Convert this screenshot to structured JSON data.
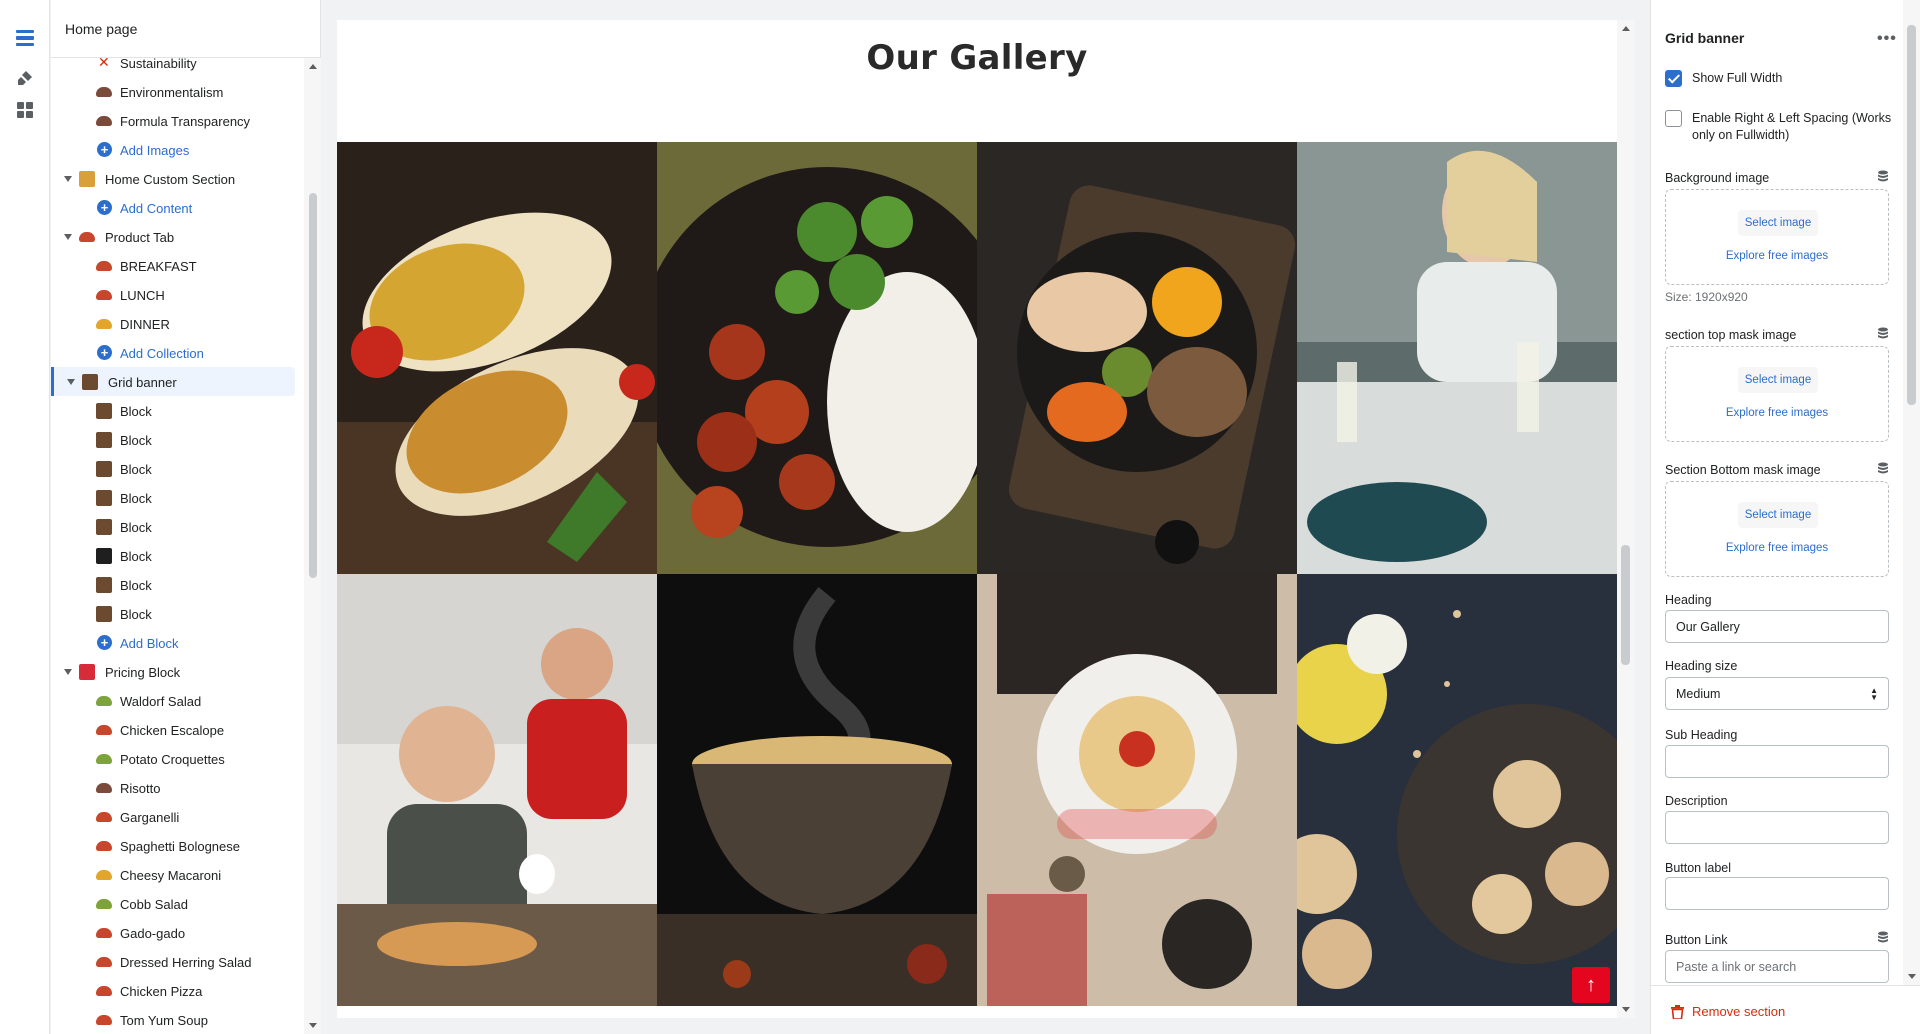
{
  "tree": {
    "header": "Home page",
    "rows": [
      {
        "type": "child",
        "label": "Sustainability",
        "thumb": "cross"
      },
      {
        "type": "child",
        "label": "Environmentalism",
        "thumb": "bowl"
      },
      {
        "type": "child",
        "label": "Formula Transparency",
        "thumb": "bowl"
      },
      {
        "type": "add",
        "label": "Add Images"
      },
      {
        "type": "section",
        "label": "Home Custom Section",
        "thumb": "multi"
      },
      {
        "type": "add",
        "label": "Add Content"
      },
      {
        "type": "section",
        "label": "Product Tab",
        "thumb": "food"
      },
      {
        "type": "child",
        "label": "BREAKFAST",
        "thumb": "food"
      },
      {
        "type": "child",
        "label": "LUNCH",
        "thumb": "food"
      },
      {
        "type": "child",
        "label": "DINNER",
        "thumb": "yellow"
      },
      {
        "type": "add",
        "label": "Add Collection"
      },
      {
        "type": "section",
        "label": "Grid banner",
        "thumb": "photo",
        "selected": true
      },
      {
        "type": "child",
        "label": "Block",
        "thumb": "photo"
      },
      {
        "type": "child",
        "label": "Block",
        "thumb": "photo"
      },
      {
        "type": "child",
        "label": "Block",
        "thumb": "photo"
      },
      {
        "type": "child",
        "label": "Block",
        "thumb": "photo"
      },
      {
        "type": "child",
        "label": "Block",
        "thumb": "photo"
      },
      {
        "type": "child",
        "label": "Block",
        "thumb": "dark"
      },
      {
        "type": "child",
        "label": "Block",
        "thumb": "photo"
      },
      {
        "type": "child",
        "label": "Block",
        "thumb": "photo"
      },
      {
        "type": "add",
        "label": "Add Block"
      },
      {
        "type": "section",
        "label": "Pricing Block",
        "thumb": "pricing"
      },
      {
        "type": "child",
        "label": "Waldorf Salad",
        "thumb": "salad"
      },
      {
        "type": "child",
        "label": "Chicken Escalope",
        "thumb": "food"
      },
      {
        "type": "child",
        "label": "Potato Croquettes",
        "thumb": "salad"
      },
      {
        "type": "child",
        "label": "Risotto",
        "thumb": "bowl"
      },
      {
        "type": "child",
        "label": "Garganelli",
        "thumb": "food"
      },
      {
        "type": "child",
        "label": "Spaghetti Bolognese",
        "thumb": "food"
      },
      {
        "type": "child",
        "label": "Cheesy Macaroni",
        "thumb": "yellow"
      },
      {
        "type": "child",
        "label": "Cobb Salad",
        "thumb": "salad"
      },
      {
        "type": "child",
        "label": "Gado-gado",
        "thumb": "food"
      },
      {
        "type": "child",
        "label": "Dressed Herring Salad",
        "thumb": "food"
      },
      {
        "type": "child",
        "label": "Chicken Pizza",
        "thumb": "food"
      },
      {
        "type": "child",
        "label": "Tom Yum Soup",
        "thumb": "food"
      }
    ]
  },
  "preview": {
    "heading": "Our Gallery",
    "tiles": [
      "burrito",
      "chicken-rice",
      "chicken-bowl",
      "dinner-party",
      "friends-pizza",
      "soup-bowl",
      "spaghetti-plate",
      "dessert"
    ],
    "scroll_top_label": "↑"
  },
  "settings": {
    "title": "Grid banner",
    "show_full_width": {
      "label": "Show Full Width",
      "checked": true
    },
    "spacing": {
      "label": "Enable Right & Left Spacing (Works only on Fullwidth)",
      "checked": false
    },
    "background_image": {
      "label": "Background image",
      "select": "Select image",
      "explore": "Explore free images",
      "size": "Size: 1920x920"
    },
    "top_mask": {
      "label": "section top mask image",
      "select": "Select image",
      "explore": "Explore free images"
    },
    "bottom_mask": {
      "label": "Section Bottom mask image",
      "select": "Select image",
      "explore": "Explore free images"
    },
    "heading": {
      "label": "Heading",
      "value": "Our Gallery"
    },
    "heading_size": {
      "label": "Heading size",
      "value": "Medium"
    },
    "sub_heading": {
      "label": "Sub Heading",
      "value": ""
    },
    "description": {
      "label": "Description",
      "value": ""
    },
    "button_label": {
      "label": "Button label",
      "value": ""
    },
    "button_link": {
      "label": "Button Link",
      "placeholder": "Paste a link or search"
    },
    "remove": "Remove section"
  },
  "colors": {
    "accent": "#2c6ecb",
    "danger": "#d72c0d",
    "scroll_btn": "#e4051f"
  }
}
